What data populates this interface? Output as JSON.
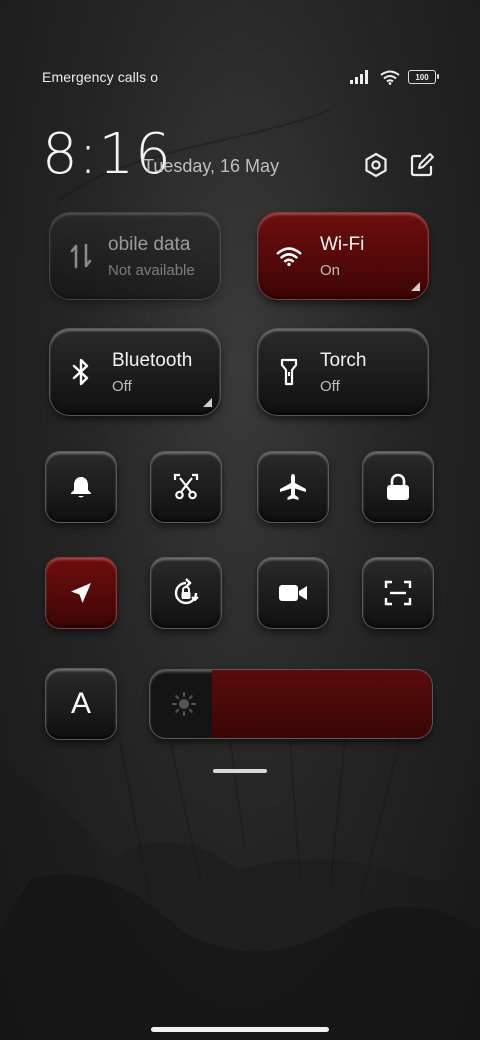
{
  "status_bar": {
    "carrier": "Emergency calls o",
    "battery": "100"
  },
  "header": {
    "time": "8:16",
    "date": "Tuesday, 16 May"
  },
  "wide_tiles": {
    "mobile_data": {
      "title": "obile data",
      "sub": "Not available"
    },
    "wifi": {
      "title": "Wi-Fi",
      "sub": "On"
    },
    "bluetooth": {
      "title": "Bluetooth",
      "sub": "Off"
    },
    "torch": {
      "title": "Torch",
      "sub": "Off"
    }
  },
  "font_button": {
    "label": "A"
  },
  "brightness": {
    "level": 0.78
  },
  "colors": {
    "accent": "#5a0b0b",
    "tile": "#151515"
  }
}
